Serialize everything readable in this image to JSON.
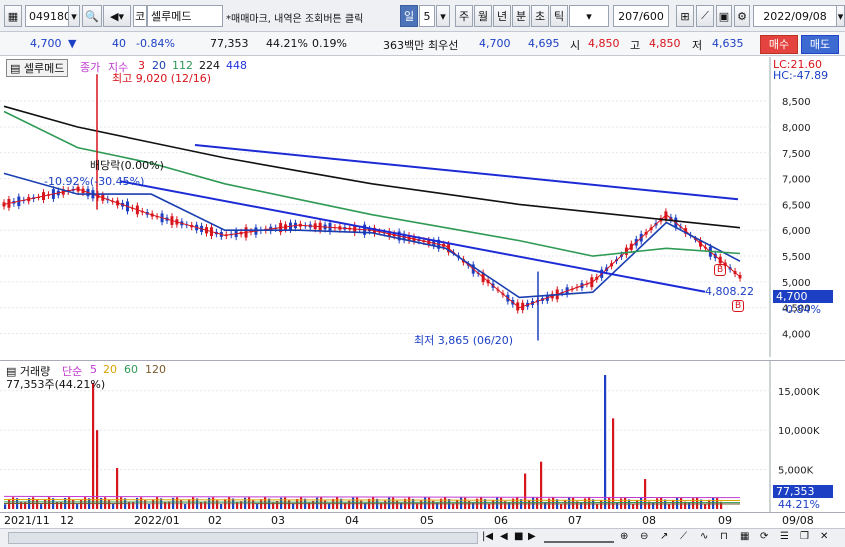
{
  "toolbar": {
    "code": "049180",
    "name": "셀루메드",
    "prefix": "코",
    "notice": "*매매마크, 내역은 조회버튼 클릭",
    "periods": [
      "일",
      "5",
      "주",
      "월",
      "년",
      "분",
      "초",
      "틱"
    ],
    "count": "207",
    "count_max": "/600",
    "date": "2022/09/08"
  },
  "info": {
    "price": "4,700",
    "change": "40",
    "change_pct": "-0.84%",
    "volume": "77,353",
    "vol_ratio": "44.21%",
    "turnover": "0.19%",
    "amount": "363백만",
    "best_sell_label": "최우선",
    "best_ask": "4,700",
    "best_bid": "4,695",
    "open_label": "시",
    "open": "4,850",
    "high_label": "고",
    "high": "4,850",
    "low_label": "저",
    "low": "4,635",
    "buy": "매수",
    "sell": "매도"
  },
  "price_panel": {
    "stock_tag": "셀루메드",
    "legend_close": "종가",
    "legend_index": "지수",
    "ma": [
      "3",
      "20",
      "112",
      "224",
      "448"
    ],
    "ma_colors": [
      "#d8141c",
      "#1a3fb0",
      "#2f9a55",
      "#111111",
      "#2233dd"
    ],
    "lc": "LC:21.60",
    "hc": "HC:-47.89",
    "high_annot": "최고 9,020 (12/16)",
    "low_annot": "최저 3,865 (06/20)",
    "dividend": "배당락(0.00%)",
    "trend_annot": "-10.92%(-30.45%)",
    "trend_end": "4,808.22",
    "price_tag": "4,700",
    "pct_tag": "-0.84%",
    "y_ticks": [
      "8,500",
      "8,000",
      "7,500",
      "7,000",
      "6,500",
      "6,000",
      "5,500",
      "5,000",
      "4,500",
      "4,000"
    ],
    "y_values": [
      8500,
      8000,
      7500,
      7000,
      6500,
      6000,
      5500,
      5000,
      4500,
      4000
    ],
    "buy_mark": "B"
  },
  "vol_panel": {
    "title": "거래량",
    "ma_label": "단순",
    "ma": [
      "5",
      "20",
      "60",
      "120"
    ],
    "ma_colors": [
      "#c03ad0",
      "#d9a400",
      "#2f9a55",
      "#7a5a2c"
    ],
    "summary": "77,353주(44.21%)",
    "y_ticks": [
      "15,000K",
      "10,000K",
      "5,000K"
    ],
    "y_values": [
      15000,
      10000,
      5000
    ],
    "cur_vol": "77,353",
    "cur_pct": "44.21%"
  },
  "x_axis": [
    "2021/11",
    "12",
    "2022/01",
    "02",
    "03",
    "04",
    "05",
    "06",
    "07",
    "08",
    "09",
    "09/08"
  ],
  "chart_data": {
    "type": "line",
    "title": "",
    "ylabel": "",
    "ylim": [
      3700,
      9200
    ],
    "x": [
      "2021/11",
      "12",
      "2022/01",
      "02",
      "03",
      "04",
      "05",
      "06",
      "07",
      "08",
      "09"
    ],
    "series": [
      {
        "name": "3",
        "values": [
          6500,
          6800,
          6300,
          5900,
          6100,
          6000,
          5700,
          4500,
          5000,
          6300,
          5100
        ]
      },
      {
        "name": "20",
        "values": [
          7100,
          6700,
          6700,
          6000,
          6000,
          5950,
          5650,
          4700,
          4800,
          6150,
          5400
        ]
      },
      {
        "name": "112",
        "values": [
          8300,
          7600,
          7300,
          6900,
          6600,
          6300,
          6050,
          5800,
          5500,
          5650,
          5550
        ]
      },
      {
        "name": "224",
        "values": [
          8400,
          8000,
          7700,
          7400,
          7150,
          6900,
          6700,
          6500,
          6350,
          6200,
          6050
        ]
      }
    ],
    "annotations": [
      "최고 9,020 (12/16)",
      "최저 3,865 (06/20)"
    ],
    "volume_ticks": [
      15000,
      10000,
      5000
    ]
  }
}
